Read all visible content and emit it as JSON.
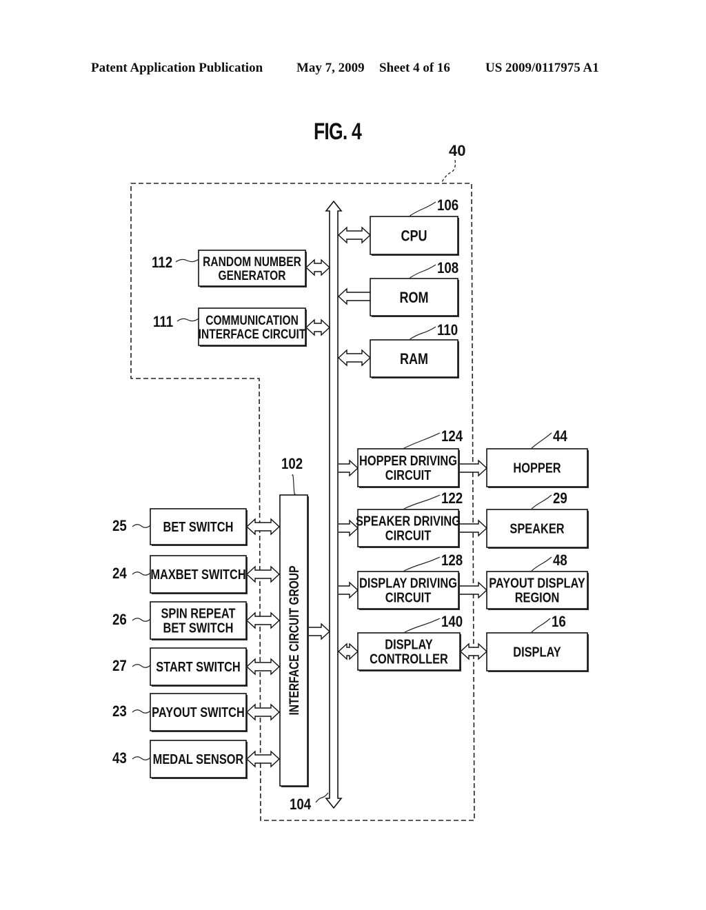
{
  "header": {
    "left": "Patent Application Publication",
    "date": "May 7, 2009",
    "sheet": "Sheet 4 of 16",
    "number": "US 2009/0117975 A1"
  },
  "figure": {
    "title": "FIG. 4",
    "boundary_ref": "40",
    "bus_ref": "104",
    "interface_group": {
      "ref": "102",
      "label": "INTERFACE CIRCUIT GROUP"
    },
    "internal_left": [
      {
        "id": "rng",
        "ref": "112",
        "lines": [
          "RANDOM NUMBER",
          "GENERATOR"
        ],
        "link": "bidirectional"
      },
      {
        "id": "comm",
        "ref": "111",
        "lines": [
          "COMMUNICATION",
          "INTERFACE CIRCUIT"
        ],
        "link": "bidirectional"
      }
    ],
    "internal_right": [
      {
        "id": "cpu",
        "ref": "106",
        "lines": [
          "CPU"
        ],
        "link": "bidirectional"
      },
      {
        "id": "rom",
        "ref": "108",
        "lines": [
          "ROM"
        ],
        "link": "to-bus"
      },
      {
        "id": "ram",
        "ref": "110",
        "lines": [
          "RAM"
        ],
        "link": "bidirectional"
      },
      {
        "id": "hopper-driver",
        "ref": "124",
        "lines": [
          "HOPPER DRIVING",
          "CIRCUIT"
        ],
        "link": "from-bus"
      },
      {
        "id": "speaker-driver",
        "ref": "122",
        "lines": [
          "SPEAKER DRIVING",
          "CIRCUIT"
        ],
        "link": "from-bus"
      },
      {
        "id": "display-driver",
        "ref": "128",
        "lines": [
          "DISPLAY DRIVING",
          "CIRCUIT"
        ],
        "link": "from-bus"
      },
      {
        "id": "display-controller",
        "ref": "140",
        "lines": [
          "DISPLAY",
          "CONTROLLER"
        ],
        "link": "bidirectional"
      }
    ],
    "external_right": [
      {
        "id": "hopper",
        "ref": "44",
        "lines": [
          "HOPPER"
        ],
        "link": "output"
      },
      {
        "id": "speaker",
        "ref": "29",
        "lines": [
          "SPEAKER"
        ],
        "link": "output"
      },
      {
        "id": "payout-display",
        "ref": "48",
        "lines": [
          "PAYOUT DISPLAY",
          "REGION"
        ],
        "link": "output"
      },
      {
        "id": "display",
        "ref": "16",
        "lines": [
          "DISPLAY"
        ],
        "link": "bidirectional"
      }
    ],
    "external_left": [
      {
        "id": "bet-switch",
        "ref": "25",
        "lines": [
          "BET SWITCH"
        ]
      },
      {
        "id": "maxbet-switch",
        "ref": "24",
        "lines": [
          "MAXBET SWITCH"
        ]
      },
      {
        "id": "spin-repeat",
        "ref": "26",
        "lines": [
          "SPIN REPEAT",
          "BET SWITCH"
        ]
      },
      {
        "id": "start-switch",
        "ref": "27",
        "lines": [
          "START SWITCH"
        ]
      },
      {
        "id": "payout-switch",
        "ref": "23",
        "lines": [
          "PAYOUT SWITCH"
        ]
      },
      {
        "id": "medal-sensor",
        "ref": "43",
        "lines": [
          "MEDAL SENSOR"
        ]
      }
    ]
  }
}
